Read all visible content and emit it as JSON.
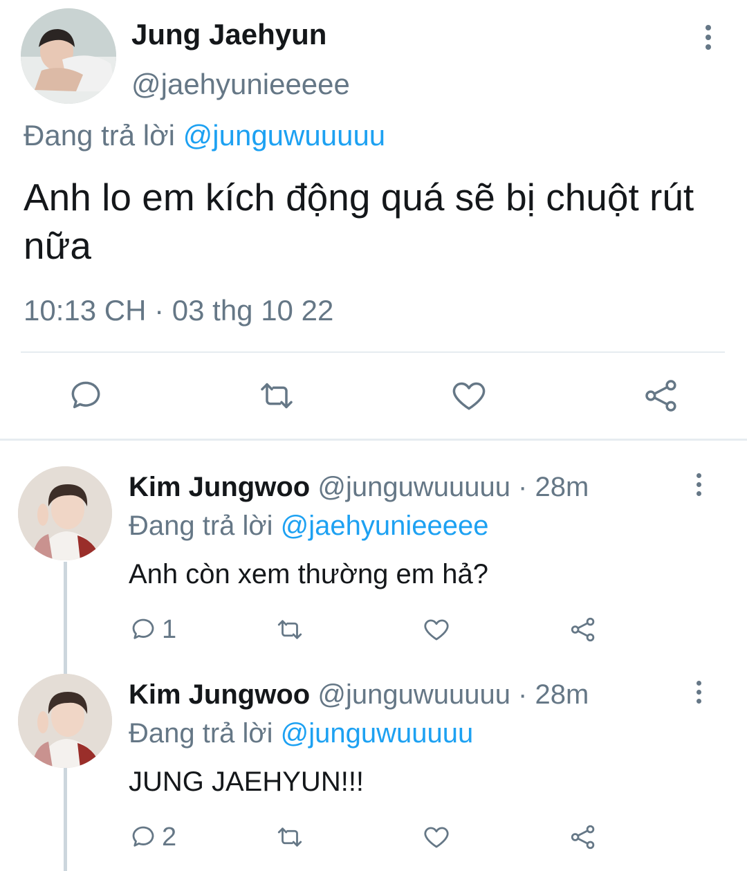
{
  "main_tweet": {
    "name": "Jung Jaehyun",
    "handle": "@jaehyunieeeee",
    "replying_label": "Đang trả lời",
    "replying_to": "@junguwuuuuu",
    "text": "Anh lo em kích động quá sẽ bị chuột rút nữa",
    "timestamp": "10:13 CH · 03 thg 10 22",
    "actions": [
      "reply-icon",
      "retweet-icon",
      "like-icon",
      "share-icon"
    ]
  },
  "replies": [
    {
      "name": "Kim Jungwoo",
      "handle_time": "@junguwuuuuu · 28m",
      "replying_label": "Đang trả lời",
      "replying_to": "@jaehyunieeeee",
      "text": "Anh còn xem thường em hả?",
      "reply_count": "1"
    },
    {
      "name": "Kim Jungwoo",
      "handle_time": "@junguwuuuuu · 28m",
      "replying_label": "Đang trả lời",
      "replying_to": "@junguwuuuuu",
      "text": "JUNG JAEHYUN!!!",
      "reply_count": "2"
    }
  ],
  "colors": {
    "link": "#1da1f2",
    "secondary_text": "#657786",
    "primary_text": "#14171a",
    "divider": "#e6ecf0"
  }
}
